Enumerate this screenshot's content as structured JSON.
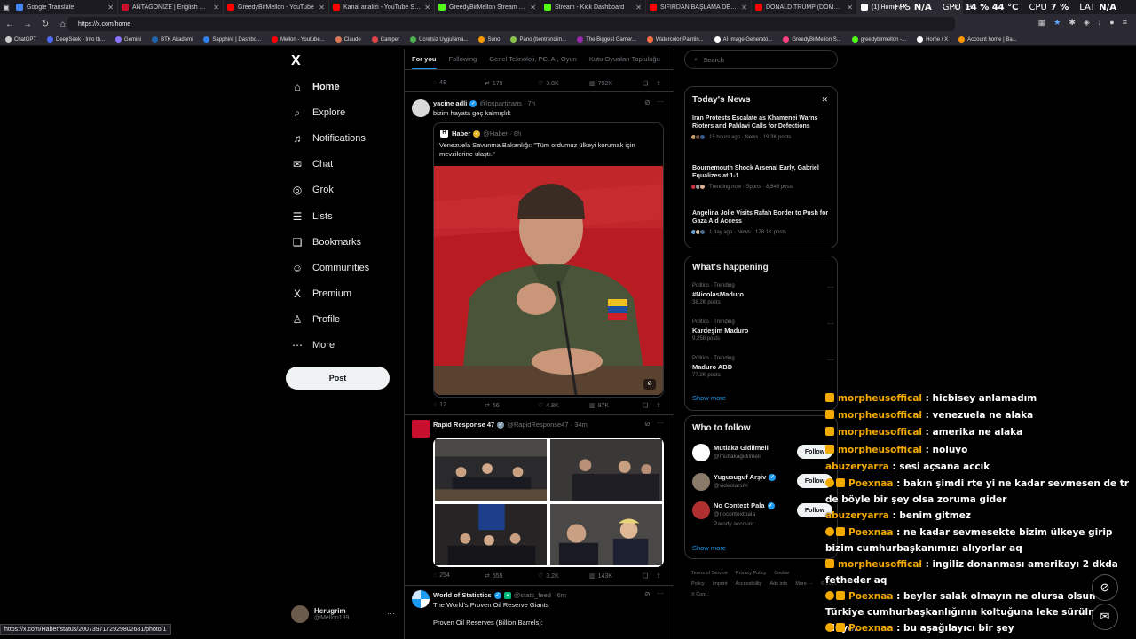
{
  "browser": {
    "tabs": [
      {
        "label": "Google Translate",
        "color": "#4285f4",
        "active": false
      },
      {
        "label": "ANTAGONIZE | English meaning -",
        "color": "#c8102e",
        "active": false
      },
      {
        "label": "GreedyBirMellon - YouTube",
        "color": "#ff0000",
        "active": false
      },
      {
        "label": "Kanal analizi - YouTube Studio",
        "color": "#ff0000",
        "active": false
      },
      {
        "label": "GreedyBirMellon Stream - Watch",
        "color": "#53fc18",
        "active": false
      },
      {
        "label": "Stream - Kick Dashboard",
        "color": "#53fc18",
        "active": false
      },
      {
        "label": "SIFIRDAN BAŞLAMA DERSİ ? ( BU",
        "color": "#ff0000",
        "active": false
      },
      {
        "label": "DONALD TRUMP (DOMBRA TRAP",
        "color": "#ff0000",
        "active": false
      },
      {
        "label": "(1) Home / X",
        "color": "#ffffff",
        "active": true
      }
    ],
    "sysstats": [
      {
        "label": "FPS",
        "value": "N/A"
      },
      {
        "label": "GPU",
        "value": "14 %  44 °C"
      },
      {
        "label": "CPU",
        "value": "7 %"
      },
      {
        "label": "LAT",
        "value": "N/A"
      }
    ],
    "url": "https://x.com/home",
    "bookmarks": [
      {
        "label": "ChatGPT",
        "color": "#cccccc"
      },
      {
        "label": "DeepSeek - Into th...",
        "color": "#4d6bfe"
      },
      {
        "label": "Gemini",
        "color": "#8e75ff"
      },
      {
        "label": "BTK Akademi",
        "color": "#1d63ad"
      },
      {
        "label": "Sapphire | Dashbo...",
        "color": "#2f80ed"
      },
      {
        "label": "Mellon - Youtube...",
        "color": "#ff0000"
      },
      {
        "label": "Claude",
        "color": "#d97757"
      },
      {
        "label": "Camper",
        "color": "#e04646"
      },
      {
        "label": "Ücretsiz Uygulama...",
        "color": "#4caf50"
      },
      {
        "label": "Suno",
        "color": "#ff9900"
      },
      {
        "label": "Pano (bentrendim...",
        "color": "#8bc34a"
      },
      {
        "label": "The Biggest Gamer...",
        "color": "#9c27b0"
      },
      {
        "label": "Watercolor Paintin...",
        "color": "#ff7043"
      },
      {
        "label": "AI Image Generato...",
        "color": "#ffffff"
      },
      {
        "label": "GreedyBirMellon S...",
        "color": "#ff4081"
      },
      {
        "label": "greedybirmellon -...",
        "color": "#53fc18"
      },
      {
        "label": "Home / X",
        "color": "#ffffff"
      },
      {
        "label": "Account home | Ba...",
        "color": "#ff9800"
      }
    ],
    "status_url": "https://x.com/Haber/status/2007397172929802681/photo/1"
  },
  "sidebar": {
    "items": [
      {
        "label": "Home",
        "icon": "home-icon",
        "glyph": "⌂"
      },
      {
        "label": "Explore",
        "icon": "search-icon",
        "glyph": "⌕"
      },
      {
        "label": "Notifications",
        "icon": "bell-icon",
        "glyph": "♫"
      },
      {
        "label": "Chat",
        "icon": "mail-icon",
        "glyph": "✉"
      },
      {
        "label": "Grok",
        "icon": "grok-icon",
        "glyph": "◎"
      },
      {
        "label": "Lists",
        "icon": "list-icon",
        "glyph": "☰"
      },
      {
        "label": "Bookmarks",
        "icon": "bookmark-icon",
        "glyph": "❏"
      },
      {
        "label": "Communities",
        "icon": "people-icon",
        "glyph": "☺"
      },
      {
        "label": "Premium",
        "icon": "x-icon",
        "glyph": "X"
      },
      {
        "label": "Profile",
        "icon": "person-icon",
        "glyph": "♙"
      },
      {
        "label": "More",
        "icon": "more-circle-icon",
        "glyph": "⋯"
      }
    ],
    "post_label": "Post",
    "account": {
      "name": "Herugrim",
      "handle": "@Mellon199"
    }
  },
  "feed": {
    "tabs": [
      "For you",
      "Following",
      "Genel Teknoloji, PC, AI, Oyun",
      "Kutu Oyunları Topluluğu"
    ],
    "top_actions": {
      "replies": "48",
      "reposts": "179",
      "likes": "3.8K",
      "views": "792K"
    },
    "post1": {
      "name": "yacine adli",
      "handle": "@lospartizans · 7h",
      "text": "bizim hayata geç kalmışlık",
      "quote": {
        "name": "Haber",
        "handle": "@Haber · 8h",
        "text": "Venezuela Savunma Bakanlığı: \"Tüm ordumuz ülkeyi korumak için mevzilerine ulaştı.\""
      },
      "actions": {
        "replies": "12",
        "reposts": "66",
        "likes": "4.8K",
        "views": "97K"
      }
    },
    "post2": {
      "name": "Rapid Response 47",
      "handle": "@RapidResponse47 · 34m",
      "actions": {
        "replies": "254",
        "reposts": "655",
        "likes": "3.2K",
        "views": "143K"
      }
    },
    "post3": {
      "name": "World of Statistics",
      "handle": "@stats_feed · 6m",
      "text": "The World's Proven Oil Reserve Giants",
      "text2": "Proven Oil Reserves (Billion Barrels):"
    }
  },
  "right": {
    "search_placeholder": "Search",
    "news_title": "Today's News",
    "news": [
      {
        "title": "Iran Protests Escalate as Khamenei Warns Rioters and Pahlavi Calls for Defections",
        "meta": "15 hours ago · News · 19.3K posts"
      },
      {
        "title": "Bournemouth Shock Arsenal Early, Gabriel Equalizes at 1-1",
        "meta": "Trending now · Sports · 8,846 posts"
      },
      {
        "title": "Angelina Jolie Visits Rafah Border to Push for Gaza Aid Access",
        "meta": "1 day ago · News · 178.1K posts"
      }
    ],
    "happening_title": "What's happening",
    "trends": [
      {
        "category": "Politics · Trending",
        "name": "#NicolasMaduro",
        "posts": "38.2K posts"
      },
      {
        "category": "Politics · Trending",
        "name": "Kardeşim Maduro",
        "posts": "9,258 posts"
      },
      {
        "category": "Politics · Trending",
        "name": "Maduro ABD",
        "posts": "77.2K posts"
      }
    ],
    "show_more": "Show more",
    "follow_title": "Who to follow",
    "follow": [
      {
        "name": "Mutlaka Gidilmeli",
        "handle": "@mutlakagidilmeli",
        "extra": "",
        "color": "#ffffff"
      },
      {
        "name": "Yugusuguf Arşiv",
        "handle": "@videolarsivi",
        "extra": "",
        "color": "#8a7a6a"
      },
      {
        "name": "No Context Pala",
        "handle": "@nocontextpala",
        "extra": "Parody account",
        "color": "#b03030"
      }
    ],
    "follow_label": "Follow",
    "footer": [
      "Terms of Service",
      "Privacy Policy",
      "Cookie Policy",
      "Imprint",
      "Accessibility",
      "Ads info",
      "More ···",
      "© 2026 X Corp."
    ]
  },
  "chat": [
    {
      "user": "morpheusoffical",
      "msg": " : hicbisey anlamadım",
      "badges": 1,
      "ucolor": "#f2a900"
    },
    {
      "user": "morpheusoffical",
      "msg": " : venezuela ne alaka",
      "badges": 1,
      "ucolor": "#f2a900"
    },
    {
      "user": "morpheusoffical",
      "msg": " : amerika ne alaka",
      "badges": 1,
      "ucolor": "#f2a900"
    },
    {
      "user": "morpheusoffical",
      "msg": " : noluyo",
      "badges": 1,
      "ucolor": "#f2a900"
    },
    {
      "user": "abuzeryarra",
      "msg": " : sesi açsana accık",
      "badges": 0,
      "ucolor": "#f2a900"
    },
    {
      "user": "Poexnaa",
      "msg": " : bakın şimdi rte yi ne kadar sevmesen de tr de böyle bir şey olsa zoruma gider",
      "badges": 2,
      "ucolor": "#f2a900"
    },
    {
      "user": "abuzeryarra",
      "msg": " : benim gitmez",
      "badges": 0,
      "ucolor": "#f2a900"
    },
    {
      "user": "Poexnaa",
      "msg": " : ne kadar sevmesekte bizim ülkeye girip bizim cumhurbaşkanımızı alıyorlar aq",
      "badges": 2,
      "ucolor": "#f2a900"
    },
    {
      "user": "morpheusoffical",
      "msg": " : ingiliz donanması amerikayı 2 dkda fetheder aq",
      "badges": 1,
      "ucolor": "#f2a900"
    },
    {
      "user": "Poexnaa",
      "msg": " : beyler salak olmayın ne olursa olsun Türkiye cumhurbaşkanlığının koltuğuna leke sürülmüş oluyor",
      "badges": 2,
      "ucolor": "#f2a900"
    },
    {
      "user": "Poexnaa",
      "msg": " : bu aşağılayıcı bir şey",
      "badges": 2,
      "ucolor": "#f2a900"
    }
  ]
}
